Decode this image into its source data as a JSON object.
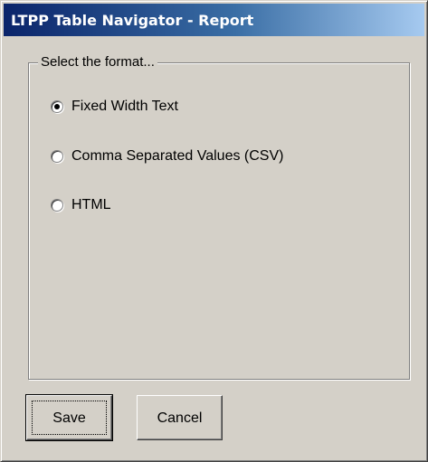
{
  "window": {
    "title": "LTPP Table Navigator - Report"
  },
  "format_group": {
    "legend": "Select the format...",
    "options": [
      {
        "label": "Fixed Width Text",
        "selected": true
      },
      {
        "label": "Comma Separated Values (CSV)",
        "selected": false
      },
      {
        "label": "HTML",
        "selected": false
      }
    ]
  },
  "buttons": {
    "save_label": "Save",
    "cancel_label": "Cancel"
  },
  "colors": {
    "dialog_background": "#d4d0c8",
    "titlebar_start": "#0a246a",
    "titlebar_end": "#a6caf0",
    "title_text": "#ffffff"
  }
}
